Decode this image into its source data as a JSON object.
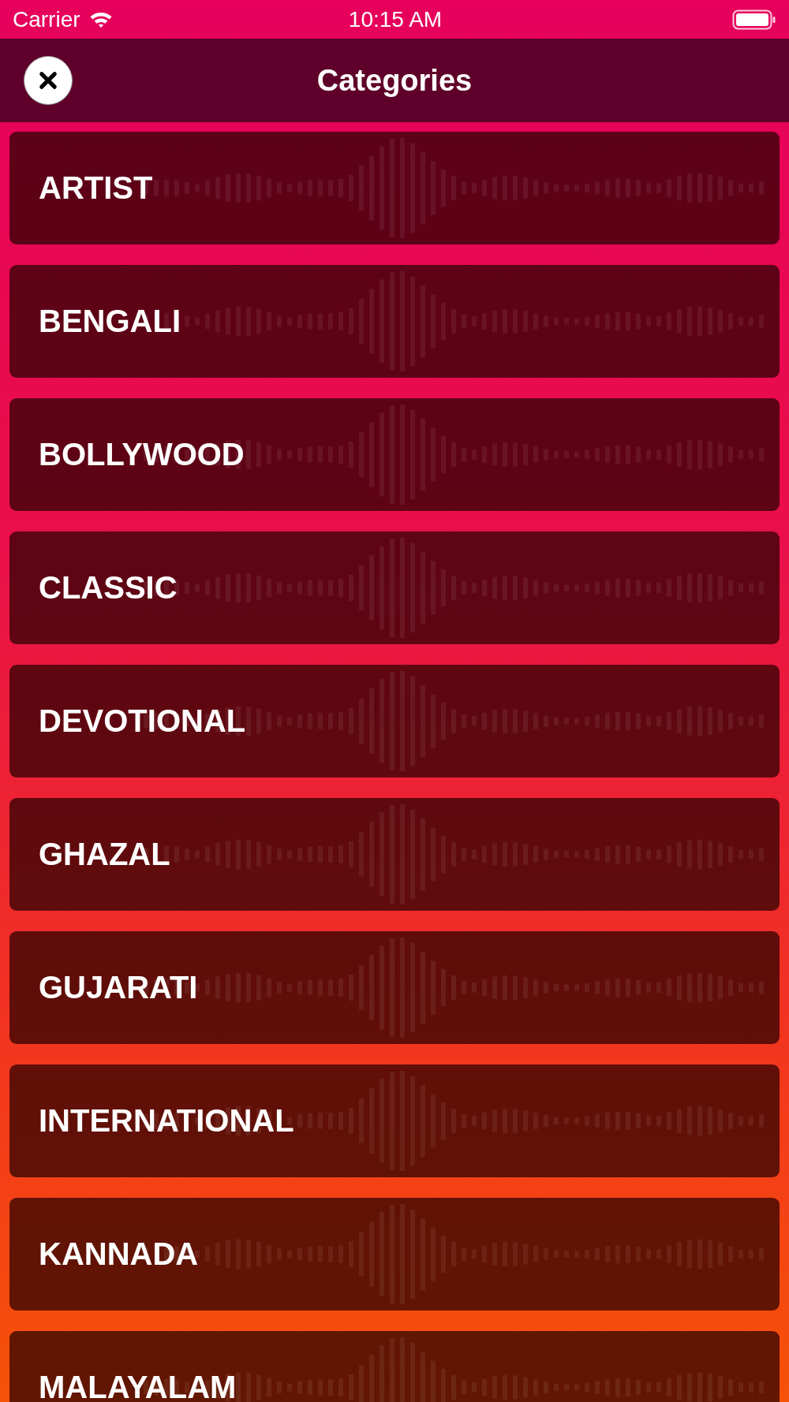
{
  "status_bar": {
    "carrier": "Carrier",
    "time": "10:15 AM"
  },
  "header": {
    "title": "Categories"
  },
  "categories": [
    {
      "label": "ARTIST"
    },
    {
      "label": "BENGALI"
    },
    {
      "label": "BOLLYWOOD"
    },
    {
      "label": "CLASSIC"
    },
    {
      "label": "DEVOTIONAL"
    },
    {
      "label": "GHAZAL"
    },
    {
      "label": "GUJARATI"
    },
    {
      "label": "INTERNATIONAL"
    },
    {
      "label": "KANNADA"
    },
    {
      "label": "MALAYALAM"
    }
  ]
}
